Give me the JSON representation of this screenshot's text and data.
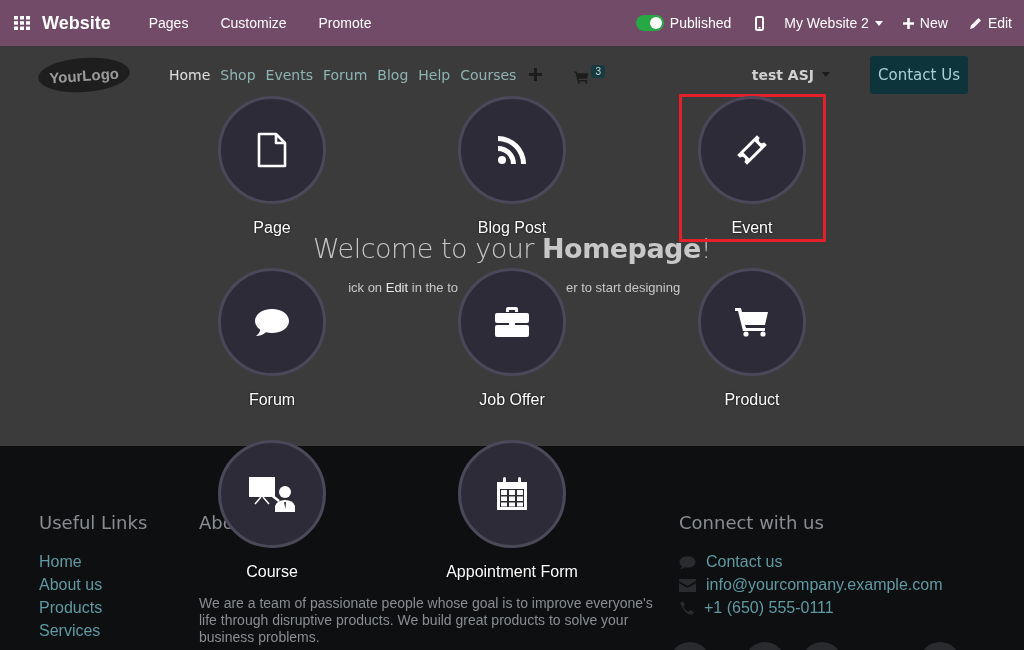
{
  "topbar": {
    "app_name": "Website",
    "menu": [
      "Pages",
      "Customize",
      "Promote"
    ],
    "publish_toggle": {
      "label": "Published",
      "on": true
    },
    "website_switcher": "My Website 2",
    "new_button": "New",
    "edit_button": "Edit"
  },
  "site": {
    "logo": "YourLogo",
    "nav": [
      {
        "label": "Home",
        "selected": true
      },
      {
        "label": "Shop",
        "selected": false
      },
      {
        "label": "Events",
        "selected": false
      },
      {
        "label": "Forum",
        "selected": false
      },
      {
        "label": "Blog",
        "selected": false
      },
      {
        "label": "Help",
        "selected": false
      },
      {
        "label": "Courses",
        "selected": false
      }
    ],
    "cart_count": "3",
    "user": "test ASJ",
    "cta": "Contact Us",
    "hero": {
      "title": "Welcome to your **Homepage**!",
      "subtitle_left": "ick on **Edit** in the to",
      "subtitle_right": "er to start designing"
    },
    "footer": {
      "links_title": "Useful Links",
      "links": [
        "Home",
        "About us",
        "Products",
        "Services"
      ],
      "about_title": "Abo",
      "about_text": "We are a team of passionate people whose goal is to improve everyone's life through disruptive products. We build great products to solve your business problems.",
      "connect_title": "Connect with us",
      "contacts": [
        {
          "kind": "chat",
          "text": "Contact us"
        },
        {
          "kind": "mail",
          "text": "info@yourcompany.example.com"
        },
        {
          "kind": "phone",
          "text": "+1 (650) 555-0111"
        }
      ]
    }
  },
  "new_content_menu": [
    {
      "kind": "page",
      "label": "Page",
      "highlighted": false
    },
    {
      "kind": "blog",
      "label": "Blog Post",
      "highlighted": false
    },
    {
      "kind": "event",
      "label": "Event",
      "highlighted": true
    },
    {
      "kind": "forum",
      "label": "Forum",
      "highlighted": false
    },
    {
      "kind": "job",
      "label": "Job Offer",
      "highlighted": false
    },
    {
      "kind": "product",
      "label": "Product",
      "highlighted": false
    },
    {
      "kind": "course",
      "label": "Course",
      "highlighted": false
    },
    {
      "kind": "appointment",
      "label": "Appointment Form",
      "highlighted": false
    }
  ]
}
